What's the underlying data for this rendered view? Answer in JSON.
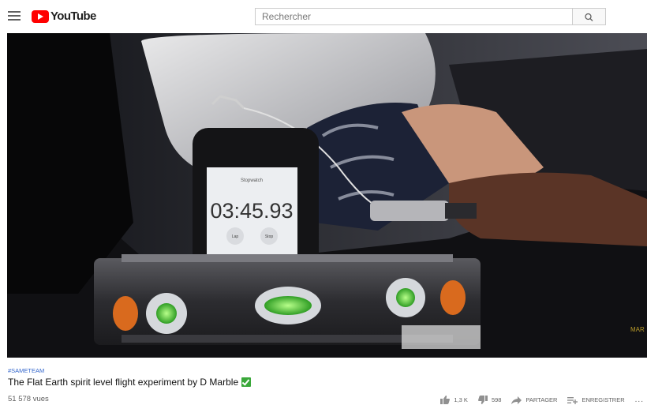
{
  "header": {
    "logo_text": "YouTube",
    "search_placeholder": "Rechercher"
  },
  "video": {
    "stopwatch_title": "Stopwatch",
    "stopwatch_time": "03:45.93",
    "lap_label": "Lap",
    "stop_label": "Stop",
    "watermark": "MAR"
  },
  "info": {
    "hashtag": "#SAMETEAM",
    "title": "The Flat Earth spirit level flight experiment by D Marble",
    "views": "51 578 vues"
  },
  "actions": {
    "likes": "1,3 K",
    "dislikes": "598",
    "share": "PARTAGER",
    "save": "ENREGISTRER",
    "more": "..."
  },
  "colors": {
    "brand": "#ff0000",
    "hashtag": "#3366cc",
    "verified_check": "#3aa83a"
  }
}
